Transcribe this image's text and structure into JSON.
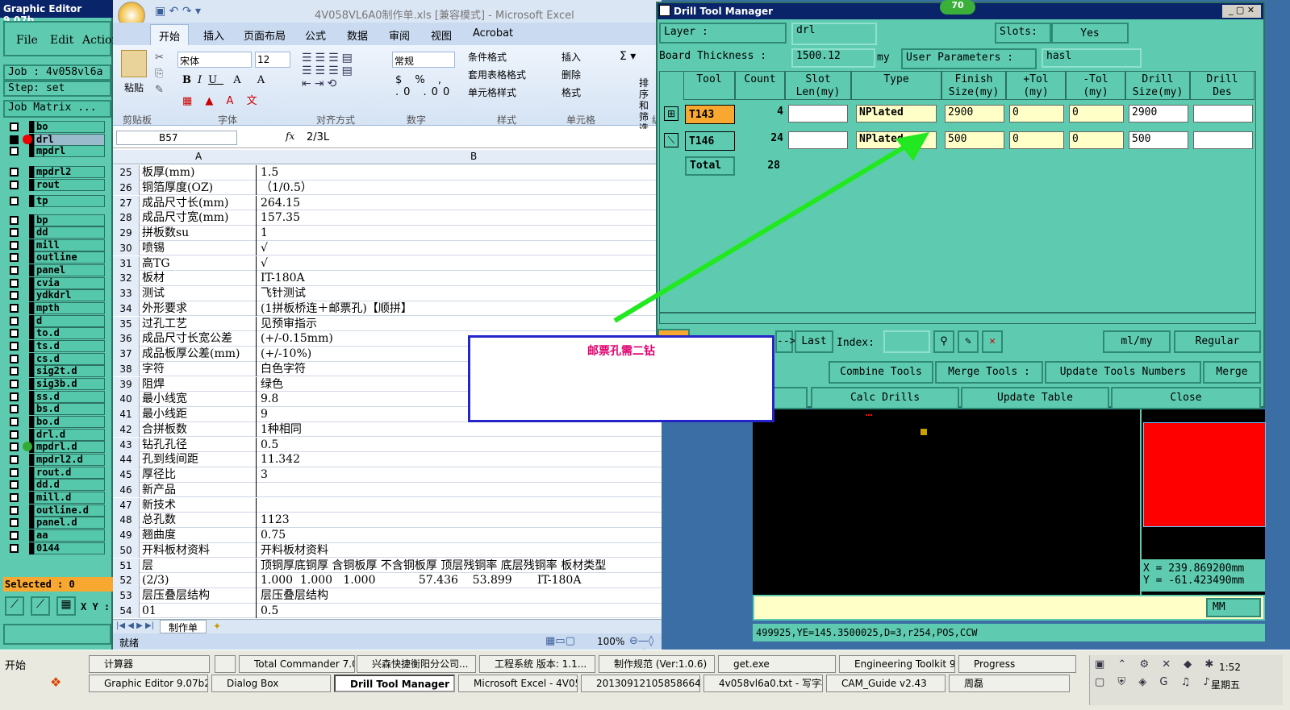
{
  "graphic_editor": {
    "title": "Graphic Editor 9.07b",
    "menu": [
      "File",
      "Edit",
      "Action"
    ],
    "job": "Job : 4v058vl6a",
    "step": "Step: set",
    "matrix": "Job Matrix ...",
    "layers": [
      "bo",
      "drl",
      "mpdrl",
      "mpdrl2",
      "rout",
      "tp",
      "bp",
      "dd",
      "mill",
      "outline",
      "panel",
      "cvia",
      "ydkdrl",
      "mpth",
      "d",
      "to.d",
      "ts.d",
      "cs.d",
      "sig2t.d",
      "sig3b.d",
      "ss.d",
      "bs.d",
      "bo.d",
      "drl.d",
      "mpdrl.d",
      "mpdrl2.d",
      "rout.d",
      "dd.d",
      "mill.d",
      "outline.d",
      "panel.d",
      "aa",
      "0144"
    ],
    "selected": "Selected : 0",
    "xy": "X Y :"
  },
  "excel": {
    "title": "4V058VL6A0制作单.xls  [兼容模式] - Microsoft Excel",
    "tabs": [
      "开始",
      "插入",
      "页面布局",
      "公式",
      "数据",
      "审阅",
      "视图",
      "Acrobat"
    ],
    "font": "宋体",
    "size": "12",
    "number_format": "常规",
    "groups": [
      "剪贴板",
      "字体",
      "对齐方式",
      "数字",
      "样式",
      "单元格",
      "编"
    ],
    "ribbon_labels": [
      "粘贴",
      "条件格式",
      "套用表格格式",
      "单元格样式",
      "插入",
      "删除",
      "格式",
      "排序和筛选"
    ],
    "name_box": "B57",
    "formula": "2/3L",
    "col_a": "A",
    "col_b": "B",
    "rows": [
      [
        "25",
        "板厚(mm)",
        "1.5"
      ],
      [
        "26",
        "铜箔厚度(OZ)",
        "（1/0.5）"
      ],
      [
        "27",
        "成品尺寸长(mm)",
        "264.15"
      ],
      [
        "28",
        "成品尺寸宽(mm)",
        "157.35"
      ],
      [
        "29",
        "拼板数su",
        "1"
      ],
      [
        "30",
        "喷锡",
        "√"
      ],
      [
        "31",
        "高TG",
        "√"
      ],
      [
        "32",
        "板材",
        "IT-180A"
      ],
      [
        "33",
        "测试",
        "飞针测试"
      ],
      [
        "34",
        "外形要求",
        "(1拼板桥连＋邮票孔)【顺拼】"
      ],
      [
        "35",
        "过孔工艺",
        "见预审指示"
      ],
      [
        "36",
        "成品尺寸长宽公差",
        "(+/-0.15mm)"
      ],
      [
        "37",
        "成品板厚公差(mm)",
        "(+/-10%)"
      ],
      [
        "38",
        "字符",
        "白色字符"
      ],
      [
        "39",
        "阻焊",
        "绿色"
      ],
      [
        "40",
        "最小线宽",
        "9.8"
      ],
      [
        "41",
        "最小线距",
        "9"
      ],
      [
        "42",
        "合拼板数",
        "1种相同"
      ],
      [
        "43",
        "钻孔孔径",
        "0.5"
      ],
      [
        "44",
        "孔到线间距",
        "11.342"
      ],
      [
        "45",
        "厚径比",
        "3"
      ],
      [
        "46",
        "新产品",
        ""
      ],
      [
        "47",
        "新技术",
        ""
      ],
      [
        "48",
        "总孔数",
        "1123"
      ],
      [
        "49",
        "翘曲度",
        "0.75"
      ],
      [
        "50",
        "开料板材资料",
        "开料板材资料"
      ],
      [
        "51",
        "层",
        "顶铜厚底铜厚 含铜板厚 不含铜板厚 顶层残铜率 底层残铜率 板材类型"
      ],
      [
        "52",
        "(2/3)",
        "1.000  1.000   1.000            57.436    53.899       IT-180A"
      ],
      [
        "53",
        "层压叠层结构",
        "层压叠层结构"
      ],
      [
        "54",
        "01",
        "0.5"
      ]
    ],
    "sheet_tab": "制作单",
    "status": "就绪",
    "zoom": "100%"
  },
  "dtm": {
    "title": "Drill Tool Manager",
    "layer_label": "Layer        :",
    "layer": "drl",
    "slots_label": "Slots:",
    "slots": "Yes",
    "thick_label": "Board Thickness :",
    "thick": "1500.12",
    "thick_unit": "my",
    "user_params": "User Parameters :",
    "user_val": "hasl",
    "headers": [
      "Tool",
      "Count",
      "Slot\nLen(my)",
      "Type",
      "Finish\nSize(my)",
      "+Tol\n(my)",
      "-Tol\n(my)",
      "Drill\nSize(my)",
      "Drill\nDes"
    ],
    "tools": [
      {
        "name": "T143",
        "count": "4",
        "type": "NPlated",
        "finish": "2900",
        "ptol": "0",
        "ntol": "0",
        "drill": "2900"
      },
      {
        "name": "T146",
        "count": "24",
        "type": "NPlated",
        "finish": "500",
        "ptol": "0",
        "ntol": "0",
        "drill": "500"
      }
    ],
    "total_label": "Total",
    "total": "28",
    "last": "Last",
    "index": "Index:",
    "units": "ml/my",
    "mode": "Regular",
    "buttons": [
      "Combine Tools",
      "Merge Tools :",
      "Update Tools Numbers",
      "Merge",
      "Calc Drills",
      "Update Table",
      "Close"
    ],
    "top_badge": "70"
  },
  "note": {
    "text": "邮票孔需二钻"
  },
  "canvas": {
    "x": "X  =  239.869200mm",
    "y": "Y  = -61.423490mm",
    "unit": "MM",
    "status": "499925,YE=145.3500025,D=3,r254,POS,CCW"
  },
  "taskbar": {
    "start": "开始",
    "row1": [
      "计算器",
      "",
      "Total Commander 7.0 ...",
      "兴森快捷衡阳分公司...",
      "工程系统  版本: 1.1...",
      "制作规范 (Ver:1.0.6)",
      "get.exe",
      "Engineering Toolkit 9.0...",
      "Progress"
    ],
    "row2": [
      "Graphic Editor 9.07b2 (...",
      "Dialog Box",
      "Drill Tool Manager",
      "Microsoft Excel - 4V058...",
      "20130912105858664.rt...",
      "4v058vl6a0.txt - 写字板",
      "CAM_Guide v2.43",
      "周磊"
    ],
    "time": "1:52",
    "day": "星期五"
  }
}
